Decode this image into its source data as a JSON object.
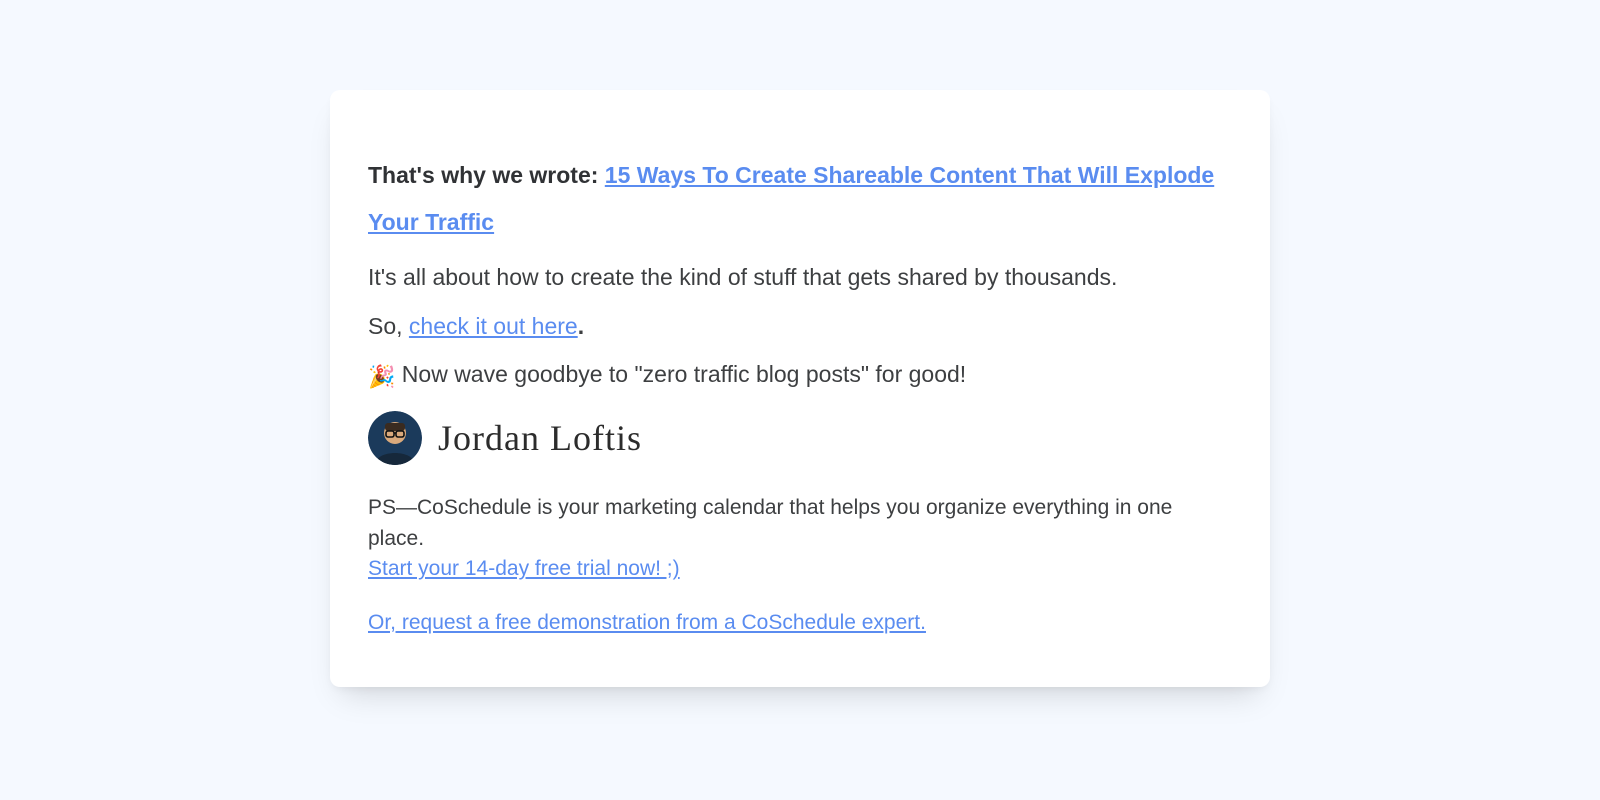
{
  "headline": {
    "prefix": "That's why we wrote: ",
    "link_text": "15 Ways To Create Shareable Content That Will Explode Your Traffic"
  },
  "paragraphs": {
    "intro": "It's all about how to create the kind of stuff that gets shared by thousands.",
    "so_prefix": "So, ",
    "check_link": "check it out here",
    "period": ".",
    "emoji": "🎉",
    "wave": " Now wave goodbye to \"zero traffic blog posts\" for good!"
  },
  "signature": {
    "name": "Jordan Loftis"
  },
  "ps": {
    "text": "PS—CoSchedule is your marketing calendar that helps you organize everything in one place. ",
    "trial_link": "Start your 14-day free trial now! ;)"
  },
  "demo_link": "Or, request a free demonstration from a CoSchedule expert."
}
